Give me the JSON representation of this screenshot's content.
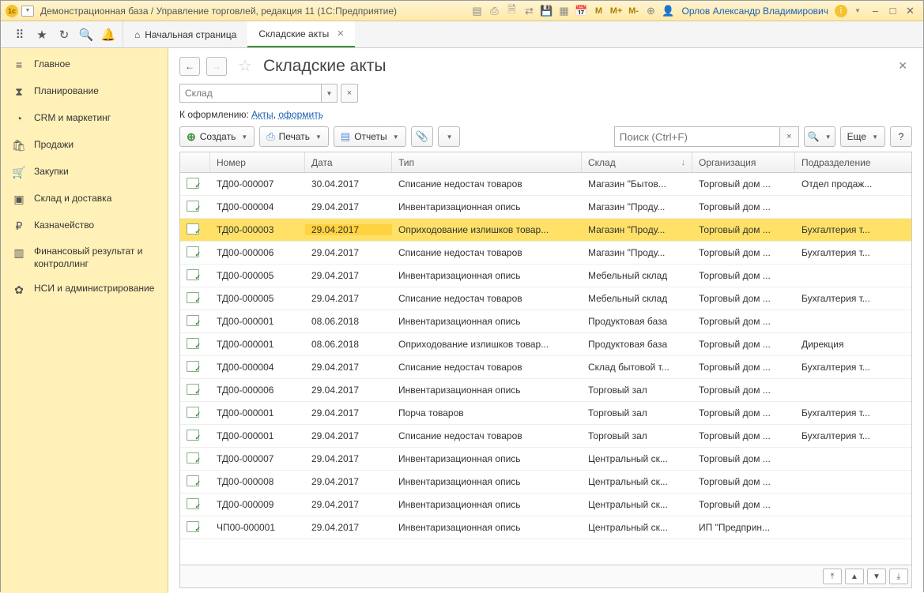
{
  "title": "Демонстрационная база / Управление торговлей, редакция 11 (1С:Предприятие)",
  "tb": {
    "m": "M",
    "mp": "M+",
    "mm": "M-"
  },
  "user": "Орлов Александр Владимирович",
  "tabs": {
    "home": "Начальная страница",
    "active": "Складские акты"
  },
  "sidebar": [
    {
      "ico": "≡",
      "lbl": "Главное"
    },
    {
      "ico": "⧗",
      "lbl": "Планирование"
    },
    {
      "ico": "◔",
      "lbl": "CRM и маркетинг"
    },
    {
      "ico": "🛍",
      "lbl": "Продажи"
    },
    {
      "ico": "🛒",
      "lbl": "Закупки"
    },
    {
      "ico": "▣",
      "lbl": "Склад и доставка"
    },
    {
      "ico": "₽",
      "lbl": "Казначейство"
    },
    {
      "ico": "▥",
      "lbl": "Финансовый результат и контроллинг"
    },
    {
      "ico": "✿",
      "lbl": "НСИ и администрирование"
    }
  ],
  "page": {
    "title": "Складские акты",
    "filter_placeholder": "Склад",
    "linkrow_pre": "К оформлению: ",
    "link_acts": "Акты",
    "link_sep": ", ",
    "link_form": "оформить",
    "create": "Создать",
    "print": "Печать",
    "reports": "Отчеты",
    "search_ph": "Поиск (Ctrl+F)",
    "more": "Еще",
    "help": "?"
  },
  "columns": {
    "num": "Номер",
    "date": "Дата",
    "type": "Тип",
    "store": "Склад",
    "org": "Организация",
    "dept": "Подразделение"
  },
  "rows": [
    {
      "n": "ТД00-000007",
      "d": "30.04.2017",
      "t": "Списание недостач товаров",
      "s": "Магазин \"Бытов...",
      "o": "Торговый дом ...",
      "p": "Отдел продаж...",
      "sel": false
    },
    {
      "n": "ТД00-000004",
      "d": "29.04.2017",
      "t": "Инвентаризационная опись",
      "s": "Магазин \"Проду...",
      "o": "Торговый дом ...",
      "p": "",
      "sel": false
    },
    {
      "n": "ТД00-000003",
      "d": "29.04.2017",
      "t": "Оприходование излишков товар...",
      "s": "Магазин \"Проду...",
      "o": "Торговый дом ...",
      "p": "Бухгалтерия т...",
      "sel": true
    },
    {
      "n": "ТД00-000006",
      "d": "29.04.2017",
      "t": "Списание недостач товаров",
      "s": "Магазин \"Проду...",
      "o": "Торговый дом ...",
      "p": "Бухгалтерия т...",
      "sel": false
    },
    {
      "n": "ТД00-000005",
      "d": "29.04.2017",
      "t": "Инвентаризационная опись",
      "s": "Мебельный склад",
      "o": "Торговый дом ...",
      "p": "",
      "sel": false
    },
    {
      "n": "ТД00-000005",
      "d": "29.04.2017",
      "t": "Списание недостач товаров",
      "s": "Мебельный склад",
      "o": "Торговый дом ...",
      "p": "Бухгалтерия т...",
      "sel": false
    },
    {
      "n": "ТД00-000001",
      "d": "08.06.2018",
      "t": "Инвентаризационная опись",
      "s": "Продуктовая база",
      "o": "Торговый дом ...",
      "p": "",
      "sel": false
    },
    {
      "n": "ТД00-000001",
      "d": "08.06.2018",
      "t": "Оприходование излишков товар...",
      "s": "Продуктовая база",
      "o": "Торговый дом ...",
      "p": "Дирекция",
      "sel": false
    },
    {
      "n": "ТД00-000004",
      "d": "29.04.2017",
      "t": "Списание недостач товаров",
      "s": "Склад бытовой т...",
      "o": "Торговый дом ...",
      "p": "Бухгалтерия т...",
      "sel": false
    },
    {
      "n": "ТД00-000006",
      "d": "29.04.2017",
      "t": "Инвентаризационная опись",
      "s": "Торговый зал",
      "o": "Торговый дом ...",
      "p": "",
      "sel": false
    },
    {
      "n": "ТД00-000001",
      "d": "29.04.2017",
      "t": "Порча товаров",
      "s": "Торговый зал",
      "o": "Торговый дом ...",
      "p": "Бухгалтерия т...",
      "sel": false
    },
    {
      "n": "ТД00-000001",
      "d": "29.04.2017",
      "t": "Списание недостач товаров",
      "s": "Торговый зал",
      "o": "Торговый дом ...",
      "p": "Бухгалтерия т...",
      "sel": false
    },
    {
      "n": "ТД00-000007",
      "d": "29.04.2017",
      "t": "Инвентаризационная опись",
      "s": "Центральный ск...",
      "o": "Торговый дом ...",
      "p": "",
      "sel": false
    },
    {
      "n": "ТД00-000008",
      "d": "29.04.2017",
      "t": "Инвентаризационная опись",
      "s": "Центральный ск...",
      "o": "Торговый дом ...",
      "p": "",
      "sel": false
    },
    {
      "n": "ТД00-000009",
      "d": "29.04.2017",
      "t": "Инвентаризационная опись",
      "s": "Центральный ск...",
      "o": "Торговый дом ...",
      "p": "",
      "sel": false
    },
    {
      "n": "ЧП00-000001",
      "d": "29.04.2017",
      "t": "Инвентаризационная опись",
      "s": "Центральный ск...",
      "o": "ИП \"Предприн...",
      "p": "",
      "sel": false
    }
  ]
}
